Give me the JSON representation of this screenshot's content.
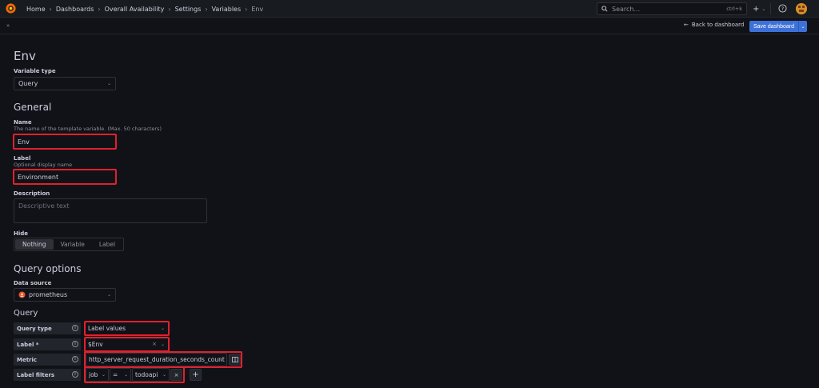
{
  "breadcrumb": [
    "Home",
    "Dashboards",
    "Overall Availability",
    "Settings",
    "Variables",
    "Env"
  ],
  "search": {
    "placeholder": "Search...",
    "shortcut": "ctrl+k"
  },
  "topbar": {
    "plus": "+"
  },
  "subbar": {
    "back_label": "Back to dashboard",
    "save_label": "Save dashboard"
  },
  "page": {
    "title": "Env"
  },
  "variable_type": {
    "label": "Variable type",
    "value": "Query"
  },
  "general": {
    "heading": "General",
    "name_label": "Name",
    "name_desc": "The name of the template variable. (Max. 50 characters)",
    "name_value": "Env",
    "label_label": "Label",
    "label_desc": "Optional display name",
    "label_value": "Environment",
    "description_label": "Description",
    "description_placeholder": "Descriptive text",
    "hide_label": "Hide",
    "hide_options": [
      "Nothing",
      "Variable",
      "Label"
    ]
  },
  "query_options": {
    "heading": "Query options",
    "datasource_label": "Data source",
    "datasource_value": "prometheus",
    "query_heading": "Query",
    "query_type_label": "Query type",
    "query_type_value": "Label values",
    "label_label": "Label *",
    "label_value": "$Env",
    "metric_label": "Metric",
    "metric_value": "http_server_request_duration_seconds_count",
    "filters_label": "Label filters",
    "filter_key": "job",
    "filter_op": "=",
    "filter_value": "todoapi",
    "add": "+"
  },
  "colors": {
    "accent": "#3d71d9",
    "highlight": "#e0202e",
    "background": "#111217"
  }
}
